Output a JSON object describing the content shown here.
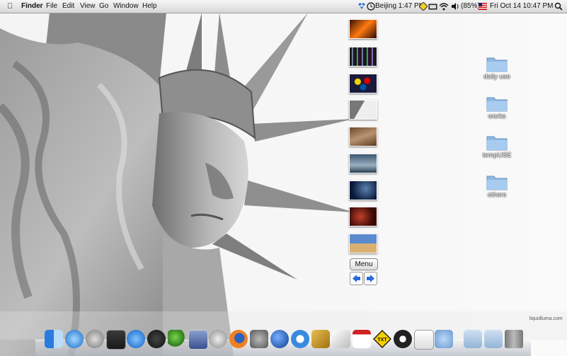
{
  "menubar": {
    "app_name": "Finder",
    "menus": [
      "File",
      "Edit",
      "View",
      "Go",
      "Window",
      "Help"
    ],
    "world_clock": "Beijing 1:47 PM",
    "battery": "(85%)",
    "clock": "Fri Oct 14  10:47 PM"
  },
  "widget": {
    "thumbnails": [
      "fire-wallpaper",
      "colorful-stripes-wallpaper",
      "billiard-balls-wallpaper",
      "statue-of-liberty-wallpaper",
      "wood-texture-wallpaper",
      "ship-at-sea-wallpaper",
      "stormy-sky-wallpaper",
      "red-abstract-wallpaper",
      "pyramids-wallpaper"
    ],
    "menu_label": "Menu"
  },
  "desktop": {
    "folders": [
      {
        "label": "daily use"
      },
      {
        "label": "works"
      },
      {
        "label": "tempUSE"
      },
      {
        "label": "others"
      }
    ],
    "watermark": "liquidluma.com"
  },
  "dock": {
    "items": [
      "finder-icon",
      "itunes-icon",
      "launchpad-rocket-icon",
      "photo-booth-icon",
      "app-store-icon",
      "dashboard-icon",
      "messenger-icon",
      "photo-app-icon",
      "disk-utility-icon",
      "firefox-icon",
      "system-preferences-icon",
      "google-earth-icon",
      "safari-icon",
      "xcode-icon",
      "pen-tool-icon",
      "calendar-icon",
      "txt-app-icon",
      "alfred-icon",
      "textedit-icon",
      "network-icon",
      "applications-folder-icon",
      "downloads-folder-icon",
      "trash-icon"
    ],
    "txt_badge": "TXT"
  }
}
